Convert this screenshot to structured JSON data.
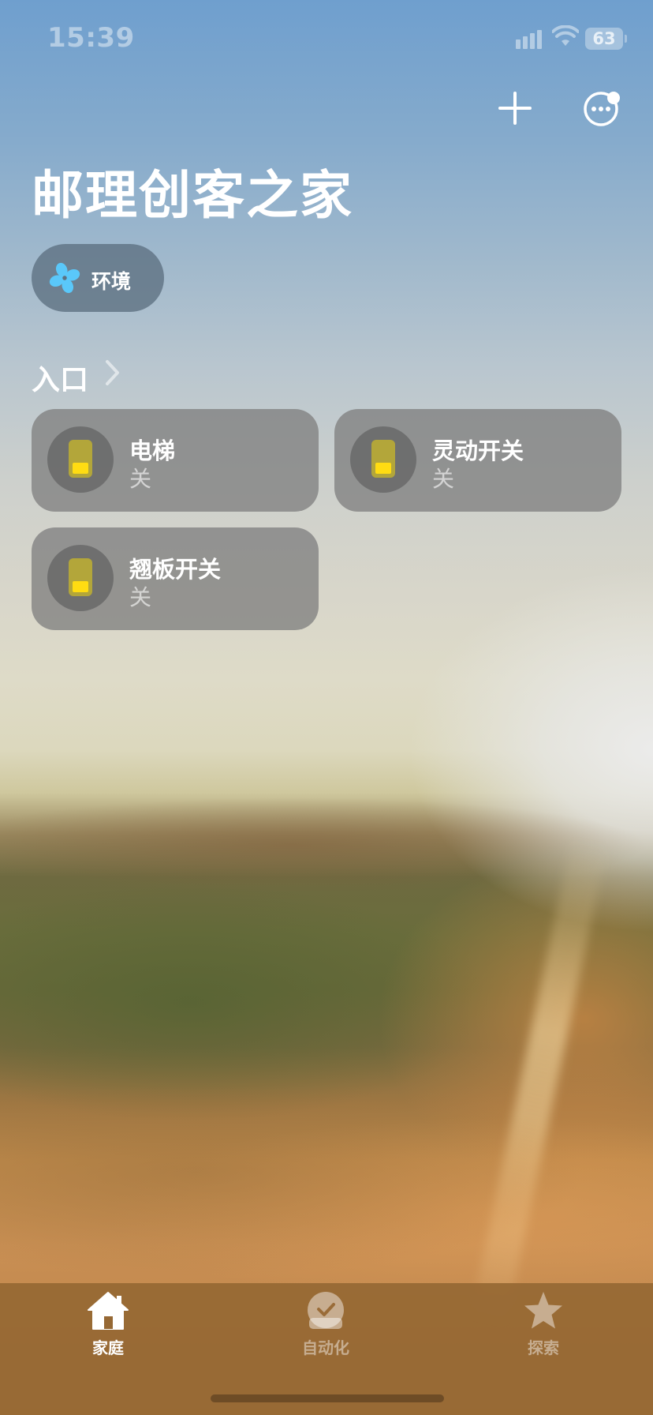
{
  "status_bar": {
    "time": "15:39",
    "battery": "63"
  },
  "header": {
    "add_icon": "plus-icon",
    "more_icon": "ellipsis-circle-icon"
  },
  "home": {
    "title": "邮理创客之家"
  },
  "categories": [
    {
      "label": "环境",
      "icon": "fan-icon",
      "icon_color": "#5ac8fa"
    }
  ],
  "room": {
    "title": "入口",
    "accessories": [
      {
        "name": "电梯",
        "state": "关",
        "icon": "light-switch-icon"
      },
      {
        "name": "灵动开关",
        "state": "关",
        "icon": "light-switch-icon"
      },
      {
        "name": "翘板开关",
        "state": "关",
        "icon": "light-switch-icon"
      }
    ]
  },
  "tabbar": {
    "tabs": [
      {
        "label": "家庭",
        "icon": "house-icon",
        "selected": true
      },
      {
        "label": "自动化",
        "icon": "clock-check-icon",
        "selected": false
      },
      {
        "label": "探索",
        "icon": "star-icon",
        "selected": false
      }
    ]
  },
  "colors": {
    "switch_body": "#b3a63a",
    "switch_active": "#ffdc12",
    "tabbar_bg": "#966834"
  }
}
